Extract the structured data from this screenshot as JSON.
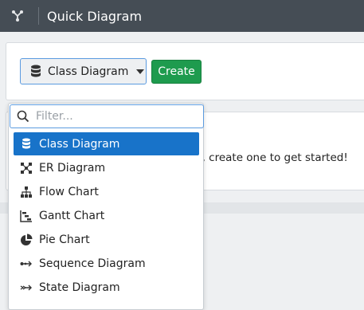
{
  "header": {
    "title": "Quick Diagram",
    "logo_icon": "tree-structure-icon"
  },
  "toolbar": {
    "selected_type": "Class Diagram",
    "create_label": "Create"
  },
  "empty_state": {
    "message": "d, create one to get started!"
  },
  "dropdown": {
    "filter_placeholder": "Filter...",
    "filter_value": "",
    "options": [
      {
        "label": "Class Diagram",
        "icon": "database-icon",
        "selected": true
      },
      {
        "label": "ER Diagram",
        "icon": "network-icon",
        "selected": false
      },
      {
        "label": "Flow Chart",
        "icon": "sitemap-icon",
        "selected": false
      },
      {
        "label": "Gantt Chart",
        "icon": "gantt-icon",
        "selected": false
      },
      {
        "label": "Pie Chart",
        "icon": "pie-chart-icon",
        "selected": false
      },
      {
        "label": "Sequence Diagram",
        "icon": "sequence-icon",
        "selected": false
      },
      {
        "label": "State Diagram",
        "icon": "state-arrow-icon",
        "selected": false
      }
    ]
  },
  "colors": {
    "topbar": "#454d55",
    "accent": "#1873c9",
    "create": "#1e9b4e"
  }
}
